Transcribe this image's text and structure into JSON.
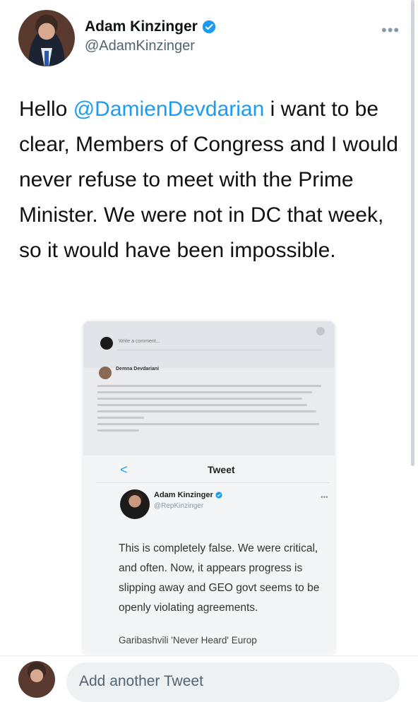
{
  "author": {
    "display_name": "Adam Kinzinger",
    "handle": "@AdamKinzinger",
    "verified": true
  },
  "more_label": "•••",
  "tweet": {
    "greeting": "Hello ",
    "mention": "@DamienDevdarian",
    "body": " i want to be clear, Members of Congress and I would never refuse to meet with the Prime Minister.  We were not in DC that week, so it would have been impossible."
  },
  "embedded_image": {
    "facebook": {
      "write_comment": "Write a comment...",
      "commenter": "Demna Devdariani"
    },
    "screen_title": "Tweet",
    "back_glyph": "<",
    "quoted_tweet": {
      "display_name": "Adam Kinzinger",
      "handle": "@RepKinzinger",
      "more": "•••",
      "text": "This is completely false.  We were critical, and often.  Now, it appears progress is slipping away and GEO govt seems to be openly violating agreements.",
      "headline_partial": "Garibashvili 'Never Heard' Europ"
    }
  },
  "composer": {
    "placeholder": "Add another Tweet"
  },
  "colors": {
    "link": "#1d9bf0",
    "secondary_text": "#536471",
    "verified_badge": "#1d9bf0"
  }
}
